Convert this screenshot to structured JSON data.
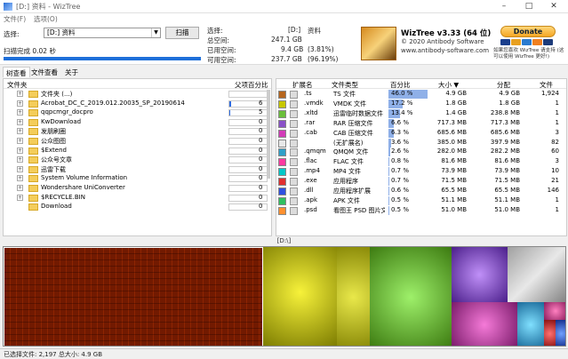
{
  "window": {
    "title": "[D:] 资料 - WizTree",
    "minimize": "–",
    "maximize": "□",
    "close": "✕"
  },
  "menu": {
    "file": "文件(F)",
    "options": "选项(O)"
  },
  "header": {
    "select_label": "选择:",
    "drive_value": "[D:] 资料",
    "scan_button": "扫描",
    "scan_status": "扫描完成 0.02 秒",
    "progress": 1.0
  },
  "stats": {
    "select_label": "选择:",
    "select_value": "[D:]",
    "select_name": "资料",
    "total_label": "总空间:",
    "total_value": "247.1 GB",
    "used_label": "已用空间:",
    "used_value": "9.4 GB",
    "used_pct": "(3.81%)",
    "free_label": "可用空间:",
    "free_value": "237.7 GB",
    "free_pct": "(96.19%)"
  },
  "brand": {
    "title": "WizTree v3.33 (64 位)",
    "copyright": "© 2020 Antibody Software",
    "url": "www.antibody-software.com",
    "donate": "Donate",
    "donate_text": "如果您喜欢 WizTree 请支持 (这可以使用 WizTree 更好!)"
  },
  "tabs": [
    "树查看",
    "文件查看",
    "关于"
  ],
  "tree": {
    "columns": {
      "folder": "文件夹",
      "parent_pct": "父项百分比"
    },
    "rows": [
      {
        "name": "文件夹 (...)",
        "expand": "+",
        "pct": 0,
        "val": ""
      },
      {
        "name": "Acrobat_DC_C_2019.012.20035_SP_20190614",
        "expand": "+",
        "pct": 0.02,
        "val": "6"
      },
      {
        "name": "qqpcmgr_docpro",
        "expand": "+",
        "pct": 0.015,
        "val": "5"
      },
      {
        "name": "KwDownload",
        "expand": "+",
        "pct": 0.0,
        "val": "0"
      },
      {
        "name": "发朋刷圈",
        "expand": "+",
        "pct": 0.0,
        "val": "0"
      },
      {
        "name": "公众图图",
        "expand": "+",
        "pct": 0.0,
        "val": "0"
      },
      {
        "name": "$Extend",
        "expand": "+",
        "pct": 0.0,
        "val": "0"
      },
      {
        "name": "公众号文章",
        "expand": "+",
        "pct": 0.0,
        "val": "0"
      },
      {
        "name": "迅雷下载",
        "expand": "+",
        "pct": 0.0,
        "val": "0"
      },
      {
        "name": "System Volume Information",
        "expand": "+",
        "pct": 0.0,
        "val": "0"
      },
      {
        "name": "Wondershare UniConverter",
        "expand": "+",
        "pct": 0.0,
        "val": "0"
      },
      {
        "name": "$RECYCLE.BIN",
        "expand": "+",
        "pct": 0.0,
        "val": "0"
      },
      {
        "name": "Download",
        "expand": "",
        "pct": 0.0,
        "val": "0"
      }
    ]
  },
  "ext": {
    "columns": {
      "ext": "扩展名",
      "type": "文件类型",
      "pct": "百分比",
      "size": "大小 ▼",
      "alloc": "分配",
      "files": "文件"
    },
    "rows": [
      {
        "color": "#b5651d",
        "ext": ".ts",
        "type": "TS 文件",
        "pct": 46.0,
        "pct_text": "46.0 %",
        "size": "4.9 GB",
        "alloc": "4.9 GB",
        "files": "1,924"
      },
      {
        "color": "#c8c800",
        "ext": ".vmdk",
        "type": "VMDK 文件",
        "pct": 17.2,
        "pct_text": "17.2 %",
        "size": "1.8 GB",
        "alloc": "1.8 GB",
        "files": "1"
      },
      {
        "color": "#6bbf3b",
        "ext": ".xltd",
        "type": "迅雷临时数据文件",
        "pct": 13.4,
        "pct_text": "13.4 %",
        "size": "1.4 GB",
        "alloc": "238.8 MB",
        "files": "1"
      },
      {
        "color": "#8a52c8",
        "ext": ".rar",
        "type": "RAR 压缩文件",
        "pct": 6.6,
        "pct_text": "6.6 %",
        "size": "717.3 MB",
        "alloc": "717.3 MB",
        "files": "1"
      },
      {
        "color": "#d23cb8",
        "ext": ".cab",
        "type": "CAB 压缩文件",
        "pct": 6.3,
        "pct_text": "6.3 %",
        "size": "685.6 MB",
        "alloc": "685.6 MB",
        "files": "3"
      },
      {
        "color": "#e8e8e8",
        "ext": "",
        "type": "(无扩展名)",
        "pct": 3.6,
        "pct_text": "3.6 %",
        "size": "385.0 MB",
        "alloc": "397.9 MB",
        "files": "82"
      },
      {
        "color": "#2fa0c8",
        "ext": ".qmqm",
        "type": "QMQM 文件",
        "pct": 2.6,
        "pct_text": "2.6 %",
        "size": "282.0 MB",
        "alloc": "282.2 MB",
        "files": "60"
      },
      {
        "color": "#ff3aa0",
        "ext": ".flac",
        "type": "FLAC 文件",
        "pct": 0.8,
        "pct_text": "0.8 %",
        "size": "81.6 MB",
        "alloc": "81.6 MB",
        "files": "3"
      },
      {
        "color": "#00c8c8",
        "ext": ".mp4",
        "type": "MP4 文件",
        "pct": 0.7,
        "pct_text": "0.7 %",
        "size": "73.9 MB",
        "alloc": "73.9 MB",
        "files": "10"
      },
      {
        "color": "#e03030",
        "ext": ".exe",
        "type": "应用程序",
        "pct": 0.7,
        "pct_text": "0.7 %",
        "size": "71.5 MB",
        "alloc": "71.5 MB",
        "files": "21"
      },
      {
        "color": "#3050e0",
        "ext": ".dll",
        "type": "应用程序扩展",
        "pct": 0.6,
        "pct_text": "0.6 %",
        "size": "65.5 MB",
        "alloc": "65.5 MB",
        "files": "146"
      },
      {
        "color": "#30c060",
        "ext": ".apk",
        "type": "APK 文件",
        "pct": 0.5,
        "pct_text": "0.5 %",
        "size": "51.1 MB",
        "alloc": "51.1 MB",
        "files": "1"
      },
      {
        "color": "#ff9030",
        "ext": ".psd",
        "type": "看图王 PSD 图片文件",
        "pct": 0.5,
        "pct_text": "0.5 %",
        "size": "51.0 MB",
        "alloc": "51.0 MB",
        "files": "1"
      }
    ]
  },
  "map_label": "[D:\\]",
  "status": "已选择文件: 2,197 总大小: 4.9 GB"
}
